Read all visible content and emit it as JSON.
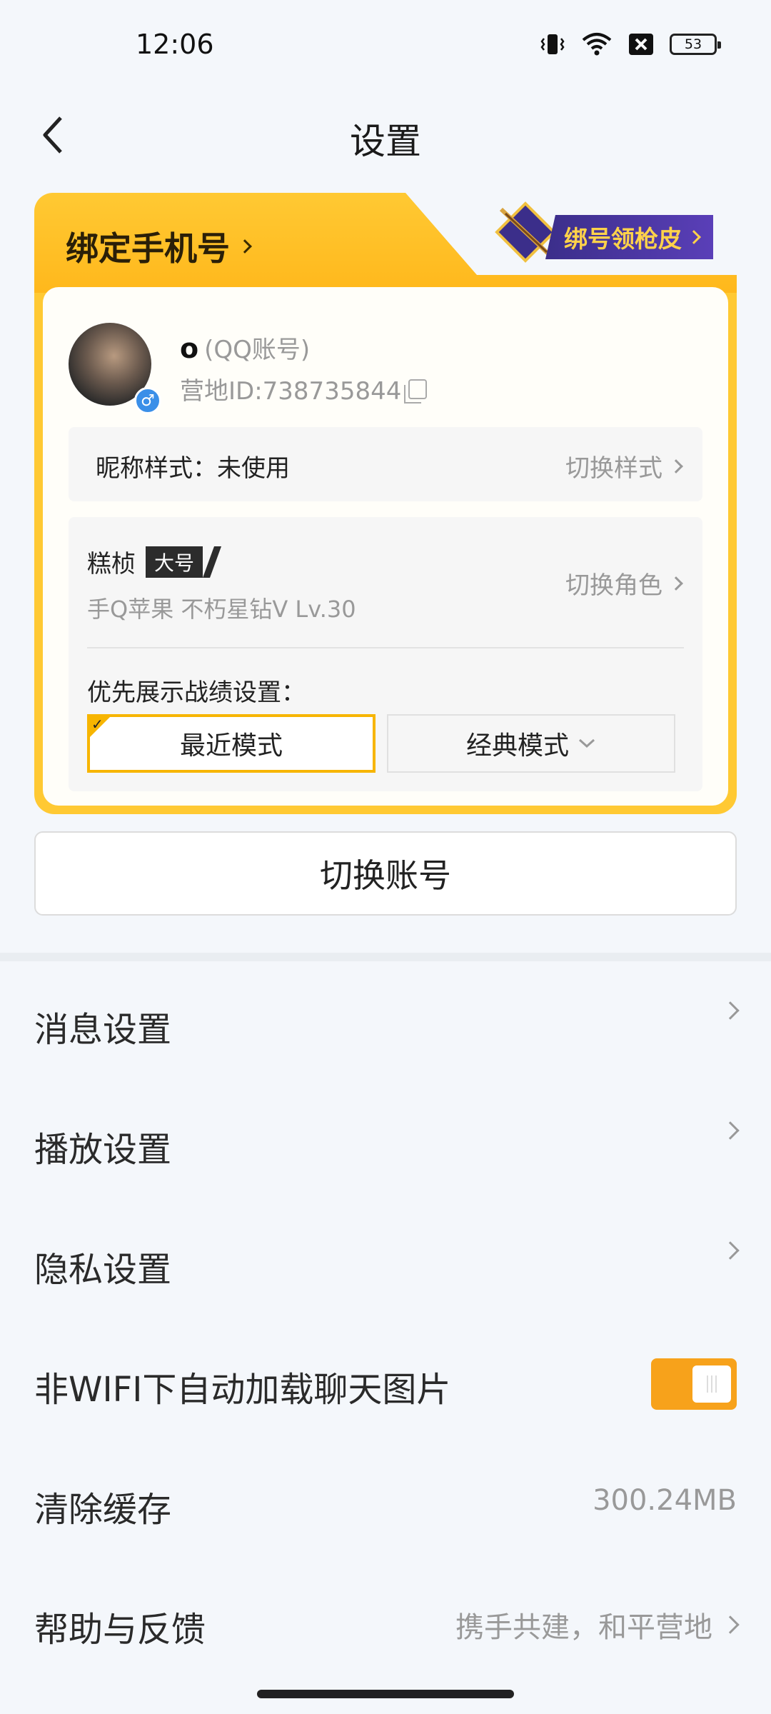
{
  "status_bar": {
    "time": "12:06",
    "battery": "53",
    "icons": [
      "vibrate-icon",
      "wifi-icon",
      "sim-off-icon",
      "battery-icon"
    ]
  },
  "header": {
    "title": "设置",
    "back_icon": "back-arrow-icon"
  },
  "card": {
    "bind_phone": "绑定手机号",
    "bind_reward": "绑号领枪皮",
    "user": {
      "name": "o",
      "account_type": "(QQ账号)",
      "camp_id": "营地ID:738735844",
      "gender_symbol": "♂"
    },
    "nickname_style": {
      "label": "昵称样式：未使用",
      "action": "切换样式"
    },
    "role": {
      "name": "糕桢",
      "tag": "大号",
      "subtitle": "手Q苹果  不朽星钻V  Lv.30",
      "action": "切换角色"
    },
    "priority_label": "优先展示战绩设置：",
    "modes": {
      "recent": "最近模式",
      "classic": "经典模式"
    }
  },
  "switch_account": "切换账号",
  "settings": {
    "messages": "消息设置",
    "playback": "播放设置",
    "privacy": "隐私设置",
    "auto_load": "非WIFI下自动加载聊天图片",
    "auto_load_on": true,
    "clear_cache": "清除缓存",
    "cache_size": "300.24MB",
    "help": "帮助与反馈",
    "help_hint": "携手共建，和平营地"
  },
  "colors": {
    "accent": "#f7b500",
    "banner": "#ffc933",
    "reward_tag": "#4a37a0",
    "toggle": "#f7a21b"
  }
}
